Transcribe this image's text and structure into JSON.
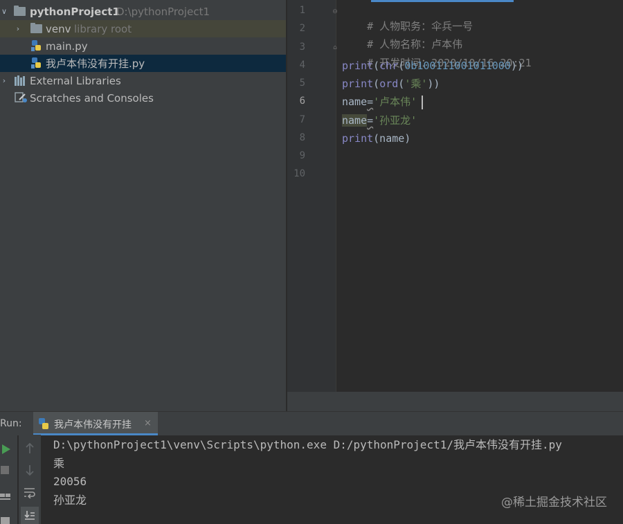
{
  "project_tree": {
    "root": {
      "name": "pythonProject1",
      "path": "D:\\pythonProject1"
    },
    "venv": {
      "name": "venv",
      "hint": "library root"
    },
    "files": [
      "main.py",
      "我卢本伟没有开挂.py"
    ],
    "external_libraries": "External Libraries",
    "scratches": "Scratches and Consoles"
  },
  "editor": {
    "line_numbers": [
      "1",
      "2",
      "3",
      "4",
      "5",
      "6",
      "7",
      "8",
      "9",
      "10"
    ],
    "lines": {
      "l1": "# 人物职务：伞兵一号",
      "l2": "# 人物名称：卢本伟",
      "l3": "# 开发时间：2020/10/16 20:21",
      "l4_fn": "print",
      "l4_p1": "(",
      "l4_fn2": "chr",
      "l4_p2": "(",
      "l4_num": "0b100111001011000",
      "l4_p3": "))",
      "l5_fn": "print",
      "l5_p1": "(",
      "l5_fn2": "ord",
      "l5_p2": "(",
      "l5_str": "'乘'",
      "l5_p3": "))",
      "l6_var": "name",
      "l6_eq": "=",
      "l6_str": "'卢本伟'",
      "l7_var": "name",
      "l7_eq": "=",
      "l7_str": "'孙亚龙'",
      "l8_fn": "print",
      "l8_rest": "(name)"
    }
  },
  "run": {
    "label": "Run:",
    "tab_name": "我卢本伟没有开挂",
    "close_glyph": "×",
    "console": [
      "D:\\pythonProject1\\venv\\Scripts\\python.exe D:/pythonProject1/我卢本伟没有开挂.py",
      "乘",
      "20056",
      "孙亚龙"
    ]
  },
  "watermark": "@稀土掘金技术社区",
  "colors": {
    "selection": "#0d293e",
    "accent": "#4a88c7",
    "run_green": "#499c54"
  }
}
